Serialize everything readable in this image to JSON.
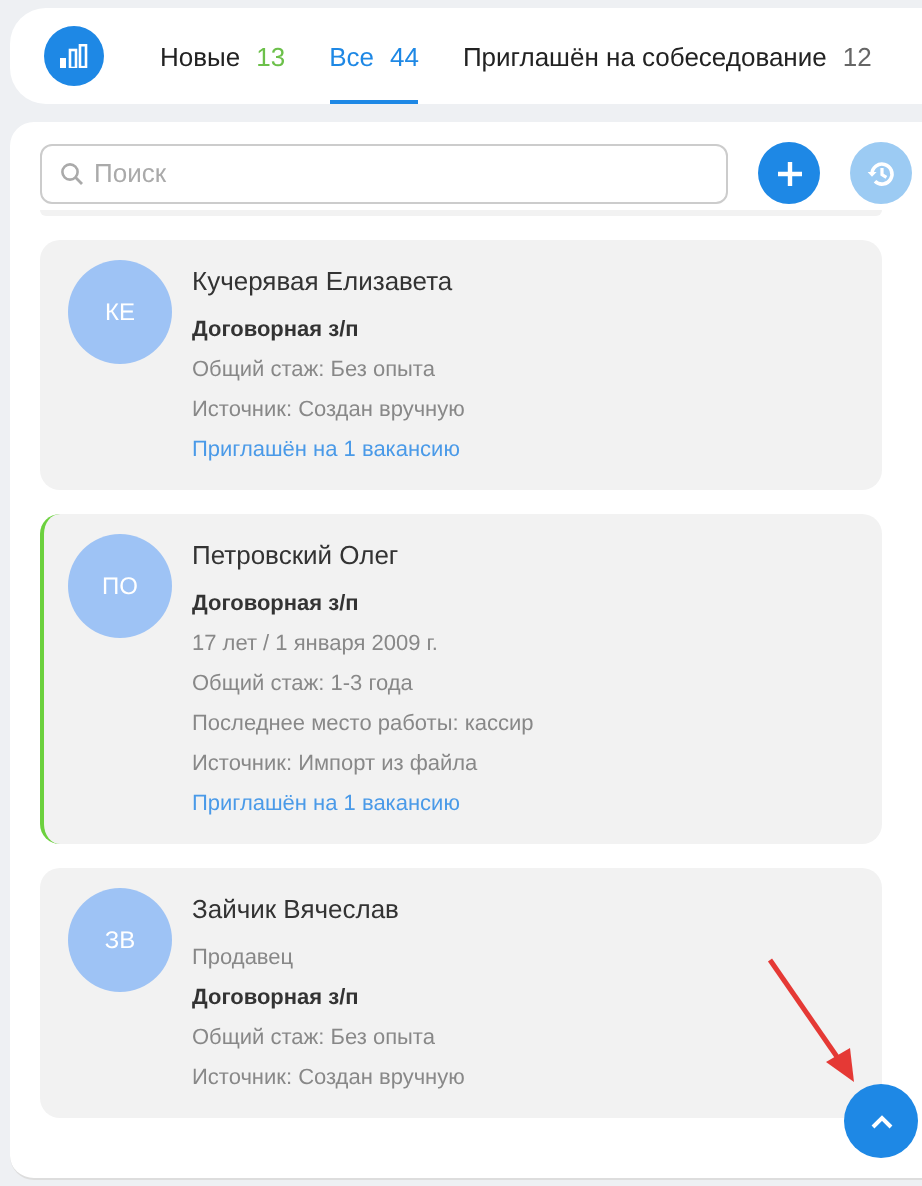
{
  "tabs": [
    {
      "label": "Новые",
      "count": "13",
      "color": "#6cc04a",
      "selected": false
    },
    {
      "label": "Все",
      "count": "44",
      "color": "#1e88e5",
      "selected": true
    },
    {
      "label": "Приглашён на собеседование",
      "count": "12",
      "color": "#666666",
      "selected": false
    }
  ],
  "search": {
    "placeholder": "Поиск"
  },
  "add_button": {
    "disabled": false
  },
  "history_button": {
    "disabled": true
  },
  "candidates": [
    {
      "initials": "КЕ",
      "name": "Кучерявая Елизавета",
      "marked": false,
      "lines": [
        {
          "kind": "salary",
          "text": "Договорная з/п"
        },
        {
          "kind": "info",
          "text": "Общий стаж:  Без опыта"
        },
        {
          "kind": "info",
          "text": "Источник:  Создан вручную"
        },
        {
          "kind": "link",
          "text": "Приглашён на 1 вакансию"
        }
      ]
    },
    {
      "initials": "ПО",
      "name": "Петровский Олег",
      "marked": true,
      "lines": [
        {
          "kind": "salary",
          "text": "Договорная з/п"
        },
        {
          "kind": "info",
          "text": "17 лет / 1 января 2009 г."
        },
        {
          "kind": "info",
          "text": "Общий стаж:  1-3 года"
        },
        {
          "kind": "info",
          "text": "Последнее место работы:  кассир"
        },
        {
          "kind": "info",
          "text": "Источник:  Импорт из файла"
        },
        {
          "kind": "link",
          "text": "Приглашён на 1 вакансию"
        }
      ]
    },
    {
      "initials": "ЗВ",
      "name": "Зайчик Вячеслав",
      "marked": false,
      "lines": [
        {
          "kind": "position",
          "text": "Продавец"
        },
        {
          "kind": "salary",
          "text": "Договорная з/п"
        },
        {
          "kind": "info",
          "text": "Общий стаж:  Без опыта"
        },
        {
          "kind": "info",
          "text": "Источник:  Создан вручную"
        }
      ]
    }
  ]
}
